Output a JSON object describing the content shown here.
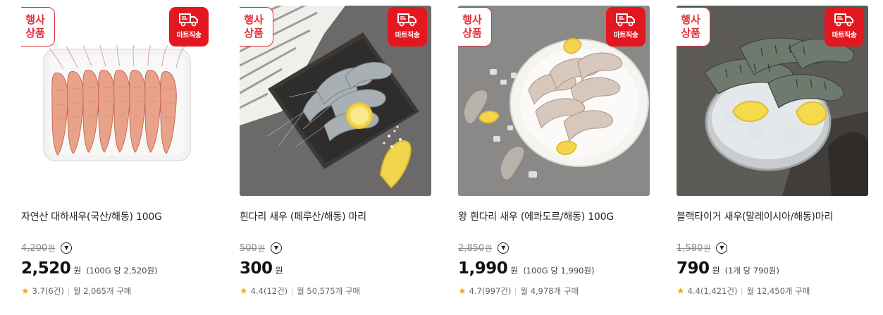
{
  "badges": {
    "event": [
      "행사",
      "상품"
    ],
    "mart": "마트직송"
  },
  "products": [
    {
      "name": "자연산 대하새우(국산/해동) 100G",
      "original_price": "4,200",
      "original_unit": "원",
      "price": "2,520",
      "won": "원",
      "unit_price": "(100G 당 2,520원)",
      "rating": "3.7",
      "reviews": "(6건)",
      "monthly": "월 2,065개 구매",
      "thumb_icon": "prawns-in-tray-image"
    },
    {
      "name": "흰다리 새우 (페루산/해동) 마리",
      "original_price": "500",
      "original_unit": "원",
      "price": "300",
      "won": "원",
      "unit_price": "",
      "rating": "4.4",
      "reviews": "(12건)",
      "monthly": "월 50,575개 구매",
      "thumb_icon": "shrimp-on-slate-image"
    },
    {
      "name": "왕 흰다리 새우 (에콰도르/해동) 100G",
      "original_price": "2,850",
      "original_unit": "원",
      "price": "1,990",
      "won": "원",
      "unit_price": "(100G 당 1,990원)",
      "rating": "4.7",
      "reviews": "(997건)",
      "monthly": "월 4,978개 구매",
      "thumb_icon": "shrimp-plate-image"
    },
    {
      "name": "블랙타이거 새우(말레이시아/해동)마리",
      "original_price": "1,580",
      "original_unit": "원",
      "price": "790",
      "won": "원",
      "unit_price": "(1개 당 790원)",
      "rating": "4.4",
      "reviews": "(1,421건)",
      "monthly": "월 12,450개 구매",
      "thumb_icon": "tiger-shrimp-bowl-image"
    }
  ],
  "colors": {
    "accent_red": "#e3171f",
    "star": "#f5a623"
  },
  "icons": {
    "dropdown": "chevron-down-circle-icon",
    "star": "star-icon",
    "truck": "truck-icon"
  }
}
